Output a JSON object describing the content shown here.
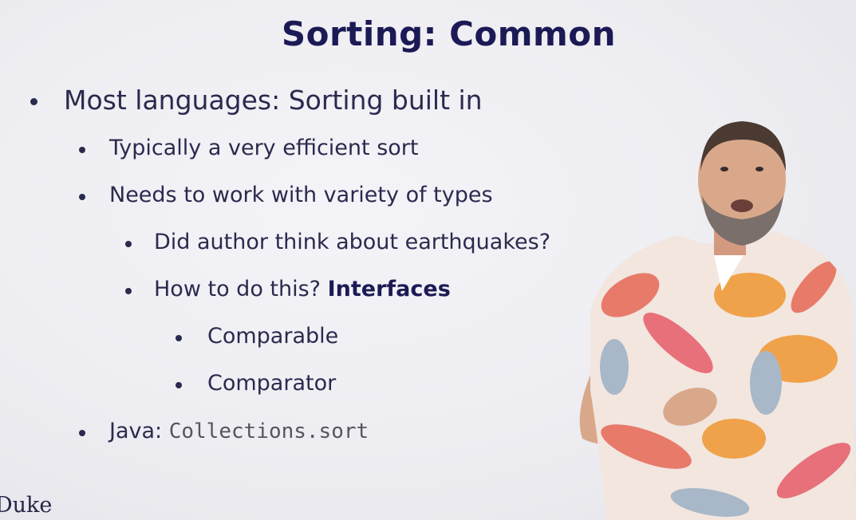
{
  "slide": {
    "title": "Sorting: Common",
    "bullets": {
      "b1": "Most languages: Sorting built in",
      "b1_1": "Typically a very efficient sort",
      "b1_2": "Needs to work with variety of types",
      "b1_2_1": "Did author think about earthquakes?",
      "b1_2_2_prefix": "How to do this? ",
      "b1_2_2_bold": "Interfaces",
      "b1_2_2_1": "Comparable",
      "b1_2_2_2": "Comparator",
      "b1_3_prefix": "Java: ",
      "b1_3_code": "Collections.sort"
    },
    "logo": "Duke"
  },
  "presenter": {
    "description_icon": "presenter-figure",
    "shirt_color": "#e87a6a",
    "accent_color": "#f0a24a"
  }
}
